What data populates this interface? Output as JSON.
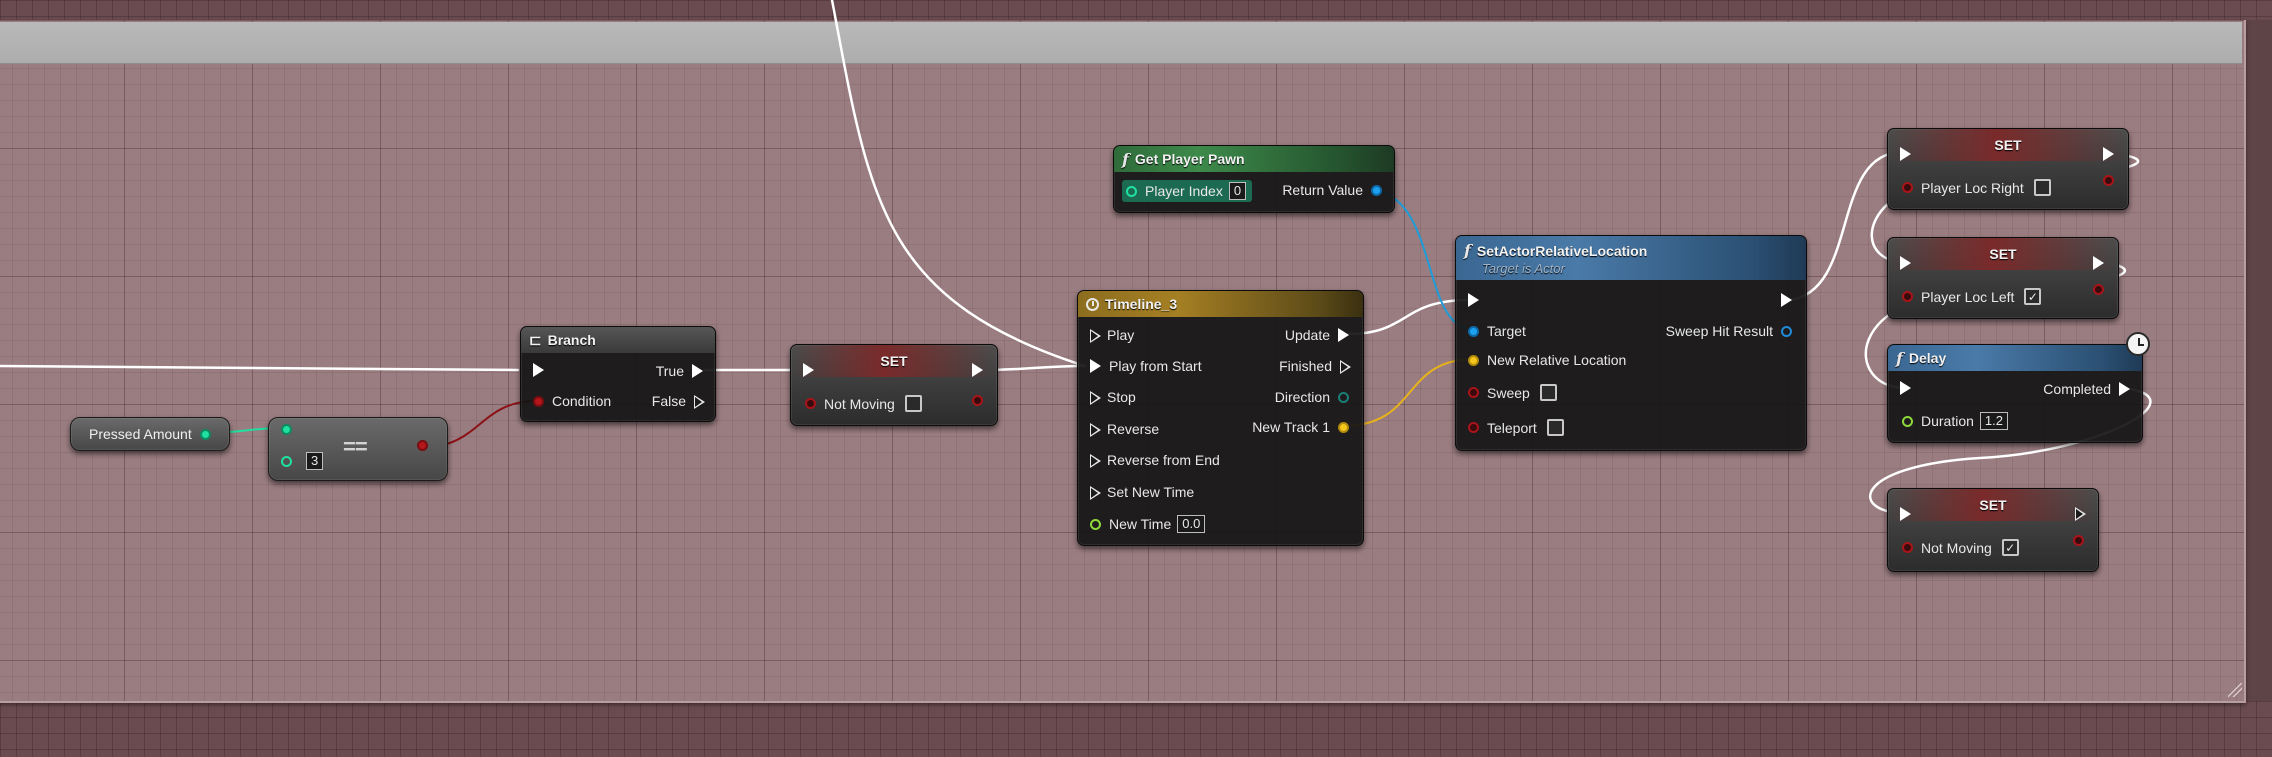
{
  "graph": {
    "nodes": {
      "pressed_amount": {
        "label": "Pressed Amount"
      },
      "equals": {
        "operator": "==",
        "input_value": "3"
      },
      "branch": {
        "title": "Branch",
        "condition": "Condition",
        "true": "True",
        "false": "False"
      },
      "set_not_moving_1": {
        "title": "SET",
        "variable": "Not Moving",
        "checked": ""
      },
      "get_player_pawn": {
        "title": "Get Player Pawn",
        "player_index": "Player Index",
        "player_index_value": "0",
        "return_value": "Return Value"
      },
      "timeline": {
        "title": "Timeline_3",
        "inputs": [
          "Play",
          "Play from Start",
          "Stop",
          "Reverse",
          "Reverse from End",
          "Set New Time"
        ],
        "new_time": "New Time",
        "new_time_value": "0.0",
        "outputs": [
          "Update",
          "Finished",
          "Direction",
          "New Track 1"
        ]
      },
      "set_actor_relative_location": {
        "title": "SetActorRelativeLocation",
        "subtitle": "Target is Actor",
        "target": "Target",
        "new_relative_location": "New Relative Location",
        "sweep": "Sweep",
        "teleport": "Teleport",
        "sweep_hit_result": "Sweep Hit Result"
      },
      "set_player_loc_right": {
        "title": "SET",
        "variable": "Player Loc Right",
        "checked": ""
      },
      "set_player_loc_left": {
        "title": "SET",
        "variable": "Player Loc Left",
        "checked": "✓"
      },
      "delay": {
        "title": "Delay",
        "completed": "Completed",
        "duration": "Duration",
        "duration_value": "1.2"
      },
      "set_not_moving_2": {
        "title": "SET",
        "variable": "Not Moving",
        "checked": "✓"
      }
    }
  },
  "colors": {
    "exec_wire": "#ffffff",
    "bool_wire": "#8b1116",
    "int_wire": "#1fe0a0",
    "object_wire": "#1e9cd8",
    "vector_wire": "#e8b31a",
    "comment_body": "#9a7d81",
    "comment_header": "#b3b3b3"
  }
}
